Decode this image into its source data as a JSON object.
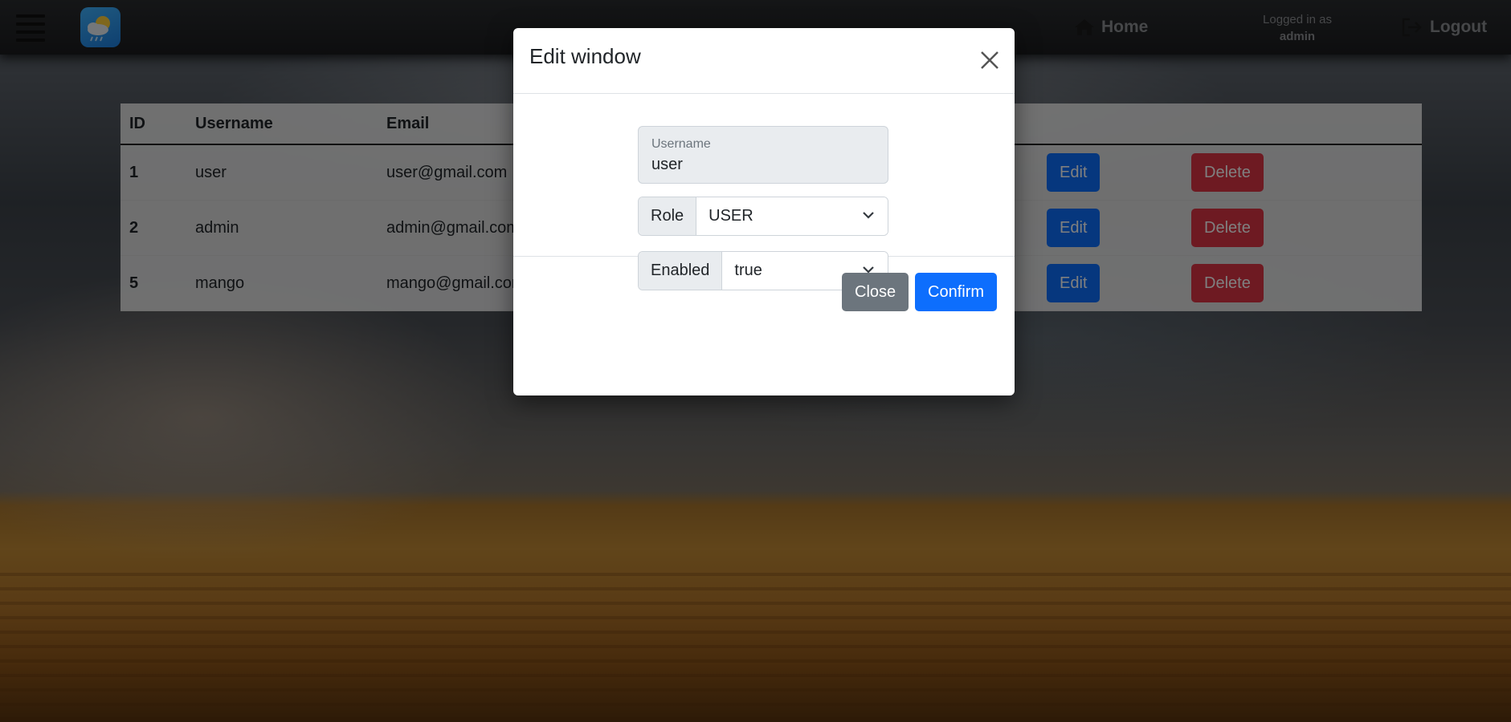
{
  "navbar": {
    "home_label": "Home",
    "logged_in_label": "Logged in as",
    "username": "admin",
    "logout_label": "Logout",
    "icons": [
      "menu-icon",
      "weather-logo",
      "home-icon",
      "logout-icon"
    ]
  },
  "table": {
    "headers": [
      "ID",
      "Username",
      "Email"
    ],
    "rows": [
      {
        "id": "1",
        "username": "user",
        "email": "user@gmail.com",
        "edit": "Edit",
        "delete": "Delete"
      },
      {
        "id": "2",
        "username": "admin",
        "email": "admin@gmail.com",
        "edit": "Edit",
        "delete": "Delete"
      },
      {
        "id": "5",
        "username": "mango",
        "email": "mango@gmail.com",
        "edit": "Edit",
        "delete": "Delete"
      }
    ]
  },
  "modal": {
    "title": "Edit window",
    "username_label": "Username",
    "username_value": "user",
    "role_label": "Role",
    "role_value": "USER",
    "enabled_label": "Enabled",
    "enabled_value": "true",
    "close_label": "Close",
    "confirm_label": "Confirm"
  },
  "colors": {
    "primary": "#0d6efd",
    "danger": "#dc3545",
    "secondary": "#6c757d"
  }
}
